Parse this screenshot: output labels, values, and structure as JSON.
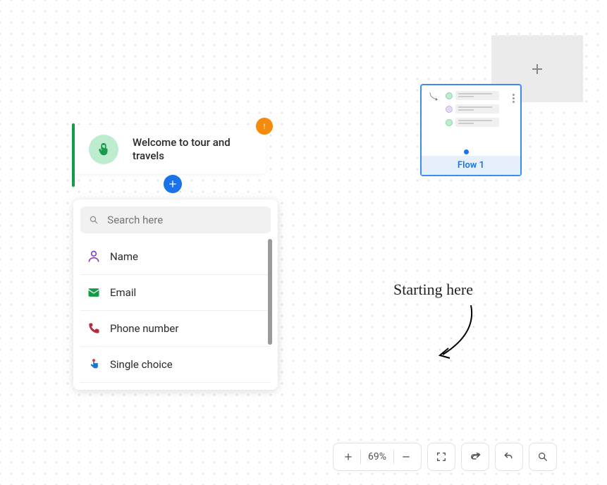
{
  "node": {
    "title": "Welcome to tour and travels"
  },
  "dropdown": {
    "search_placeholder": "Search here",
    "options": [
      {
        "label": "Name"
      },
      {
        "label": "Email"
      },
      {
        "label": "Phone number"
      },
      {
        "label": "Single choice"
      }
    ]
  },
  "flow": {
    "label": "Flow 1"
  },
  "annotation": {
    "text": "Starting here"
  },
  "toolbar": {
    "zoom_level": "69%"
  }
}
